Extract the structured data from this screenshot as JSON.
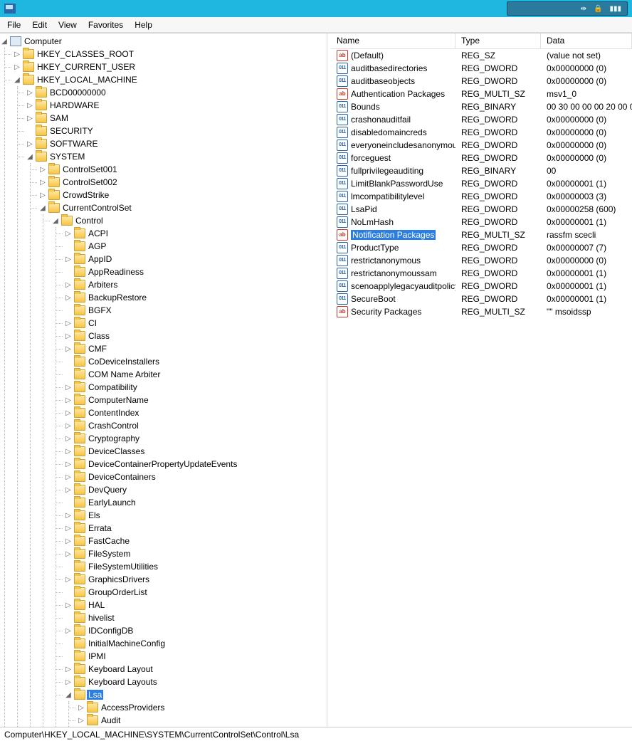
{
  "menu": {
    "file": "File",
    "edit": "Edit",
    "view": "View",
    "favorites": "Favorites",
    "help": "Help"
  },
  "columns": {
    "name": "Name",
    "type": "Type",
    "data": "Data"
  },
  "statusbar": "Computer\\HKEY_LOCAL_MACHINE\\SYSTEM\\CurrentControlSet\\Control\\Lsa",
  "tree": {
    "root": "Computer",
    "roots": [
      {
        "label": "HKEY_CLASSES_ROOT",
        "state": "collapsed"
      },
      {
        "label": "HKEY_CURRENT_USER",
        "state": "collapsed"
      },
      {
        "label": "HKEY_LOCAL_MACHINE",
        "state": "expanded",
        "children": [
          {
            "label": "BCD00000000",
            "state": "collapsed"
          },
          {
            "label": "HARDWARE",
            "state": "collapsed"
          },
          {
            "label": "SAM",
            "state": "collapsed"
          },
          {
            "label": "SECURITY",
            "state": "leaf"
          },
          {
            "label": "SOFTWARE",
            "state": "collapsed"
          },
          {
            "label": "SYSTEM",
            "state": "expanded",
            "children": [
              {
                "label": "ControlSet001",
                "state": "collapsed"
              },
              {
                "label": "ControlSet002",
                "state": "collapsed"
              },
              {
                "label": "CrowdStrike",
                "state": "collapsed"
              },
              {
                "label": "CurrentControlSet",
                "state": "expanded",
                "children": [
                  {
                    "label": "Control",
                    "state": "expanded",
                    "open": true,
                    "children": [
                      {
                        "label": "ACPI",
                        "state": "collapsed"
                      },
                      {
                        "label": "AGP",
                        "state": "leaf"
                      },
                      {
                        "label": "AppID",
                        "state": "collapsed"
                      },
                      {
                        "label": "AppReadiness",
                        "state": "leaf"
                      },
                      {
                        "label": "Arbiters",
                        "state": "collapsed"
                      },
                      {
                        "label": "BackupRestore",
                        "state": "collapsed"
                      },
                      {
                        "label": "BGFX",
                        "state": "leaf"
                      },
                      {
                        "label": "CI",
                        "state": "collapsed"
                      },
                      {
                        "label": "Class",
                        "state": "collapsed"
                      },
                      {
                        "label": "CMF",
                        "state": "collapsed"
                      },
                      {
                        "label": "CoDeviceInstallers",
                        "state": "leaf"
                      },
                      {
                        "label": "COM Name Arbiter",
                        "state": "leaf"
                      },
                      {
                        "label": "Compatibility",
                        "state": "collapsed"
                      },
                      {
                        "label": "ComputerName",
                        "state": "collapsed"
                      },
                      {
                        "label": "ContentIndex",
                        "state": "collapsed"
                      },
                      {
                        "label": "CrashControl",
                        "state": "collapsed"
                      },
                      {
                        "label": "Cryptography",
                        "state": "collapsed"
                      },
                      {
                        "label": "DeviceClasses",
                        "state": "collapsed"
                      },
                      {
                        "label": "DeviceContainerPropertyUpdateEvents",
                        "state": "collapsed"
                      },
                      {
                        "label": "DeviceContainers",
                        "state": "collapsed"
                      },
                      {
                        "label": "DevQuery",
                        "state": "collapsed"
                      },
                      {
                        "label": "EarlyLaunch",
                        "state": "leaf"
                      },
                      {
                        "label": "Els",
                        "state": "collapsed"
                      },
                      {
                        "label": "Errata",
                        "state": "collapsed"
                      },
                      {
                        "label": "FastCache",
                        "state": "collapsed"
                      },
                      {
                        "label": "FileSystem",
                        "state": "collapsed"
                      },
                      {
                        "label": "FileSystemUtilities",
                        "state": "leaf"
                      },
                      {
                        "label": "GraphicsDrivers",
                        "state": "collapsed"
                      },
                      {
                        "label": "GroupOrderList",
                        "state": "leaf"
                      },
                      {
                        "label": "HAL",
                        "state": "collapsed"
                      },
                      {
                        "label": "hivelist",
                        "state": "leaf"
                      },
                      {
                        "label": "IDConfigDB",
                        "state": "collapsed"
                      },
                      {
                        "label": "InitialMachineConfig",
                        "state": "leaf"
                      },
                      {
                        "label": "IPMI",
                        "state": "leaf"
                      },
                      {
                        "label": "Keyboard Layout",
                        "state": "collapsed"
                      },
                      {
                        "label": "Keyboard Layouts",
                        "state": "collapsed"
                      },
                      {
                        "label": "Lsa",
                        "state": "expanded",
                        "selected": true,
                        "open": true,
                        "children": [
                          {
                            "label": "AccessProviders",
                            "state": "collapsed"
                          },
                          {
                            "label": "Audit",
                            "state": "collapsed"
                          }
                        ]
                      }
                    ]
                  }
                ]
              }
            ]
          }
        ]
      }
    ]
  },
  "values": [
    {
      "icon": "str",
      "name": "(Default)",
      "type": "REG_SZ",
      "data": "(value not set)"
    },
    {
      "icon": "bin",
      "name": "auditbasedirectories",
      "type": "REG_DWORD",
      "data": "0x00000000 (0)"
    },
    {
      "icon": "bin",
      "name": "auditbaseobjects",
      "type": "REG_DWORD",
      "data": "0x00000000 (0)"
    },
    {
      "icon": "str",
      "name": "Authentication Packages",
      "type": "REG_MULTI_SZ",
      "data": "msv1_0"
    },
    {
      "icon": "bin",
      "name": "Bounds",
      "type": "REG_BINARY",
      "data": "00 30 00 00 00 20 00 0"
    },
    {
      "icon": "bin",
      "name": "crashonauditfail",
      "type": "REG_DWORD",
      "data": "0x00000000 (0)"
    },
    {
      "icon": "bin",
      "name": "disabledomaincreds",
      "type": "REG_DWORD",
      "data": "0x00000000 (0)"
    },
    {
      "icon": "bin",
      "name": "everyoneincludesanonymous",
      "type": "REG_DWORD",
      "data": "0x00000000 (0)"
    },
    {
      "icon": "bin",
      "name": "forceguest",
      "type": "REG_DWORD",
      "data": "0x00000000 (0)"
    },
    {
      "icon": "bin",
      "name": "fullprivilegeauditing",
      "type": "REG_BINARY",
      "data": "00"
    },
    {
      "icon": "bin",
      "name": "LimitBlankPasswordUse",
      "type": "REG_DWORD",
      "data": "0x00000001 (1)"
    },
    {
      "icon": "bin",
      "name": "lmcompatibilitylevel",
      "type": "REG_DWORD",
      "data": "0x00000003 (3)"
    },
    {
      "icon": "bin",
      "name": "LsaPid",
      "type": "REG_DWORD",
      "data": "0x00000258 (600)"
    },
    {
      "icon": "bin",
      "name": "NoLmHash",
      "type": "REG_DWORD",
      "data": "0x00000001 (1)"
    },
    {
      "icon": "str",
      "name": "Notification Packages",
      "type": "REG_MULTI_SZ",
      "data": "rassfm scecli",
      "selected": true
    },
    {
      "icon": "bin",
      "name": "ProductType",
      "type": "REG_DWORD",
      "data": "0x00000007 (7)"
    },
    {
      "icon": "bin",
      "name": "restrictanonymous",
      "type": "REG_DWORD",
      "data": "0x00000000 (0)"
    },
    {
      "icon": "bin",
      "name": "restrictanonymoussam",
      "type": "REG_DWORD",
      "data": "0x00000001 (1)"
    },
    {
      "icon": "bin",
      "name": "scenoapplylegacyauditpolicy",
      "type": "REG_DWORD",
      "data": "0x00000001 (1)"
    },
    {
      "icon": "bin",
      "name": "SecureBoot",
      "type": "REG_DWORD",
      "data": "0x00000001 (1)"
    },
    {
      "icon": "str",
      "name": "Security Packages",
      "type": "REG_MULTI_SZ",
      "data": "\"\" msoidssp"
    }
  ]
}
